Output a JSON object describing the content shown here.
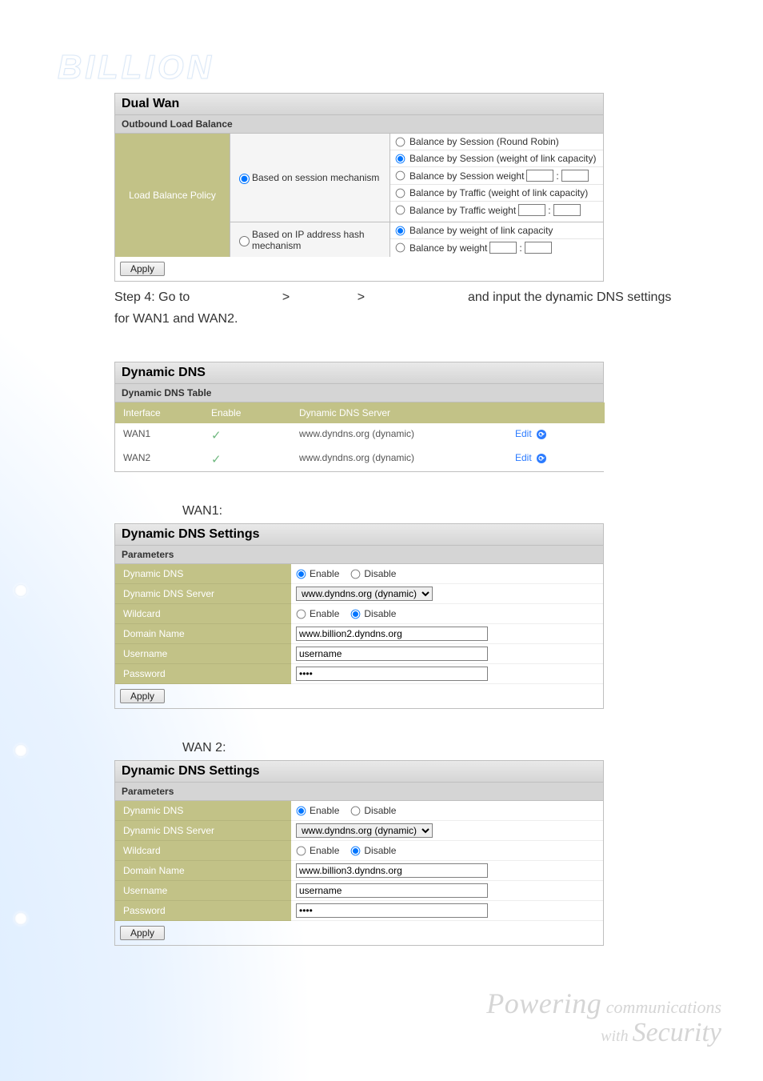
{
  "logo_text": "BILLION",
  "dual_wan": {
    "title": "Dual Wan",
    "subtitle": "Outbound Load Balance",
    "policy_label": "Load Balance Policy",
    "mode1": {
      "label": "Based on session mechanism",
      "checked": true
    },
    "mode2": {
      "label": "Based on IP address hash mechanism",
      "checked": false
    },
    "opts1": [
      {
        "label": "Balance by Session (Round Robin)",
        "checked": false,
        "has_weight": false
      },
      {
        "label": "Balance by Session (weight of link capacity)",
        "checked": true,
        "has_weight": false
      },
      {
        "label": "Balance by Session weight",
        "checked": false,
        "has_weight": true,
        "weight_sep": ":"
      },
      {
        "label": "Balance by Traffic (weight of link capacity)",
        "checked": false,
        "has_weight": false
      },
      {
        "label": "Balance by Traffic weight",
        "checked": false,
        "has_weight": true,
        "weight_sep": ":"
      }
    ],
    "opts2": [
      {
        "label": "Balance by weight of link capacity",
        "checked": true,
        "has_weight": false
      },
      {
        "label": "Balance by weight",
        "checked": false,
        "has_weight": true,
        "weight_sep": ":"
      }
    ],
    "apply": "Apply"
  },
  "step_text": {
    "prefix": "Step 4: Go to ",
    "mid1": " > ",
    "mid2": " > ",
    "suffix": " and input the dynamic DNS settings for WAN1 and WAN2."
  },
  "ddns_table": {
    "title": "Dynamic DNS",
    "subtitle": "Dynamic DNS Table",
    "headers": [
      "Interface",
      "Enable",
      "Dynamic DNS Server",
      ""
    ],
    "rows": [
      {
        "iface": "WAN1",
        "enabled": true,
        "server": "www.dyndns.org (dynamic)",
        "edit": "Edit"
      },
      {
        "iface": "WAN2",
        "enabled": true,
        "server": "www.dyndns.org (dynamic)",
        "edit": "Edit"
      }
    ]
  },
  "wan1_label": "WAN1:",
  "wan2_label": "WAN 2:",
  "ddns_settings_title": "Dynamic DNS Settings",
  "ddns_settings_sub": "Parameters",
  "labels": {
    "dyn": "Dynamic DNS",
    "server": "Dynamic DNS Server",
    "wildcard": "Wildcard",
    "domain": "Domain Name",
    "user": "Username",
    "pass": "Password",
    "enable": "Enable",
    "disable": "Disable"
  },
  "wan1": {
    "dyn": "Enable",
    "server": "www.dyndns.org (dynamic)",
    "wildcard": "Disable",
    "domain": "www.billion2.dyndns.org",
    "user": "username",
    "pass": "••••"
  },
  "wan2": {
    "dyn": "Enable",
    "server": "www.dyndns.org (dynamic)",
    "wildcard": "Disable",
    "domain": "www.billion3.dyndns.org",
    "user": "username",
    "pass": "••••"
  },
  "apply": "Apply",
  "footer": {
    "l1a": "Powering",
    "l1b": " communications",
    "l2a": "with ",
    "l2b": "Security"
  }
}
